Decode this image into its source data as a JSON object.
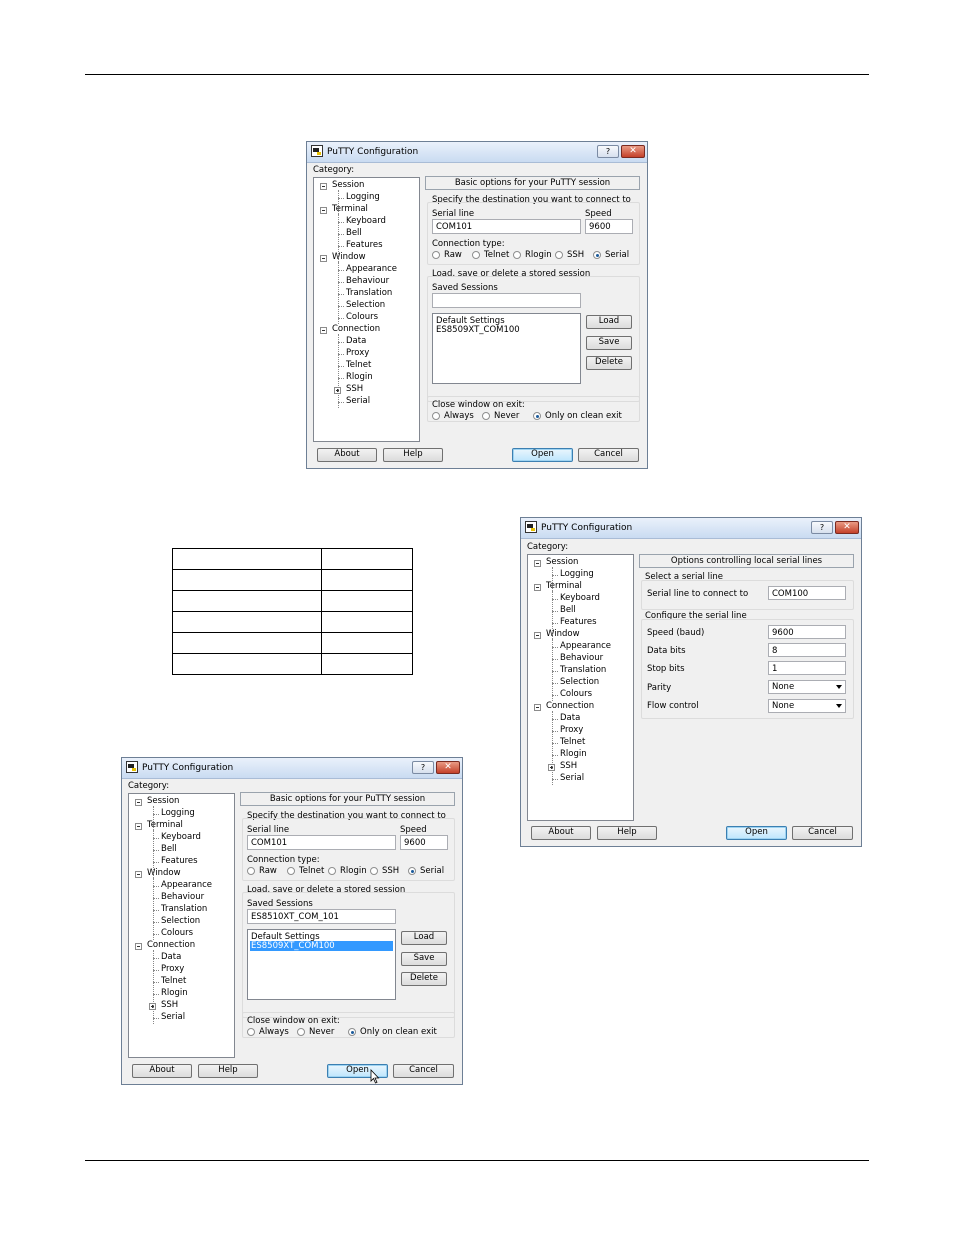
{
  "window_title": "PuTTY Configuration",
  "help_glyph": "?",
  "close_glyph": "✕",
  "category_label": "Category:",
  "tree": {
    "session": "Session",
    "logging": "Logging",
    "terminal": "Terminal",
    "keyboard": "Keyboard",
    "bell": "Bell",
    "features": "Features",
    "window": "Window",
    "appearance": "Appearance",
    "behaviour": "Behaviour",
    "translation": "Translation",
    "selection": "Selection",
    "colours": "Colours",
    "connection": "Connection",
    "data": "Data",
    "proxy": "Proxy",
    "telnet": "Telnet",
    "rlogin": "Rlogin",
    "ssh": "SSH",
    "serial": "Serial"
  },
  "session_panel": {
    "header": "Basic options for your PuTTY session",
    "dest_group": "Specify the destination you want to connect to",
    "serial_line_label": "Serial line",
    "speed_label": "Speed",
    "conn_type_label": "Connection type:",
    "conn_types": [
      "Raw",
      "Telnet",
      "Rlogin",
      "SSH",
      "Serial"
    ],
    "load_group": "Load, save or delete a stored session",
    "saved_sessions_label": "Saved Sessions",
    "close_group": "Close window on exit:",
    "close_options": [
      "Always",
      "Never",
      "Only on clean exit"
    ],
    "load_btn": "Load",
    "save_btn": "Save",
    "delete_btn": "Delete"
  },
  "buttons": {
    "about": "About",
    "help": "Help",
    "open": "Open",
    "cancel": "Cancel"
  },
  "dialog1": {
    "serial_line_value": "COM101",
    "speed_value": "9600",
    "saved_sessions_value": "",
    "sessions": [
      "Default Settings",
      "ES8509XT_COM100"
    ],
    "selected_session": ""
  },
  "dialog2": {
    "header": "Options controlling local serial lines",
    "select_group": "Select a serial line",
    "serial_line_to_connect_label": "Serial line to connect to",
    "serial_line_value": "COM100",
    "configure_group": "Configure the serial line",
    "speed_label": "Speed (baud)",
    "speed_value": "9600",
    "data_bits_label": "Data bits",
    "data_bits_value": "8",
    "stop_bits_label": "Stop bits",
    "stop_bits_value": "1",
    "parity_label": "Parity",
    "parity_value": "None",
    "flow_control_label": "Flow control",
    "flow_control_value": "None"
  },
  "dialog3": {
    "serial_line_value": "COM101",
    "speed_value": "9600",
    "saved_sessions_value": "ES8510XT_COM_101",
    "sessions": [
      "Default Settings",
      "ES8509XT_COM100"
    ],
    "selected_session": "ES8509XT_COM100"
  },
  "table": {
    "rows": 6,
    "cols": 2
  }
}
